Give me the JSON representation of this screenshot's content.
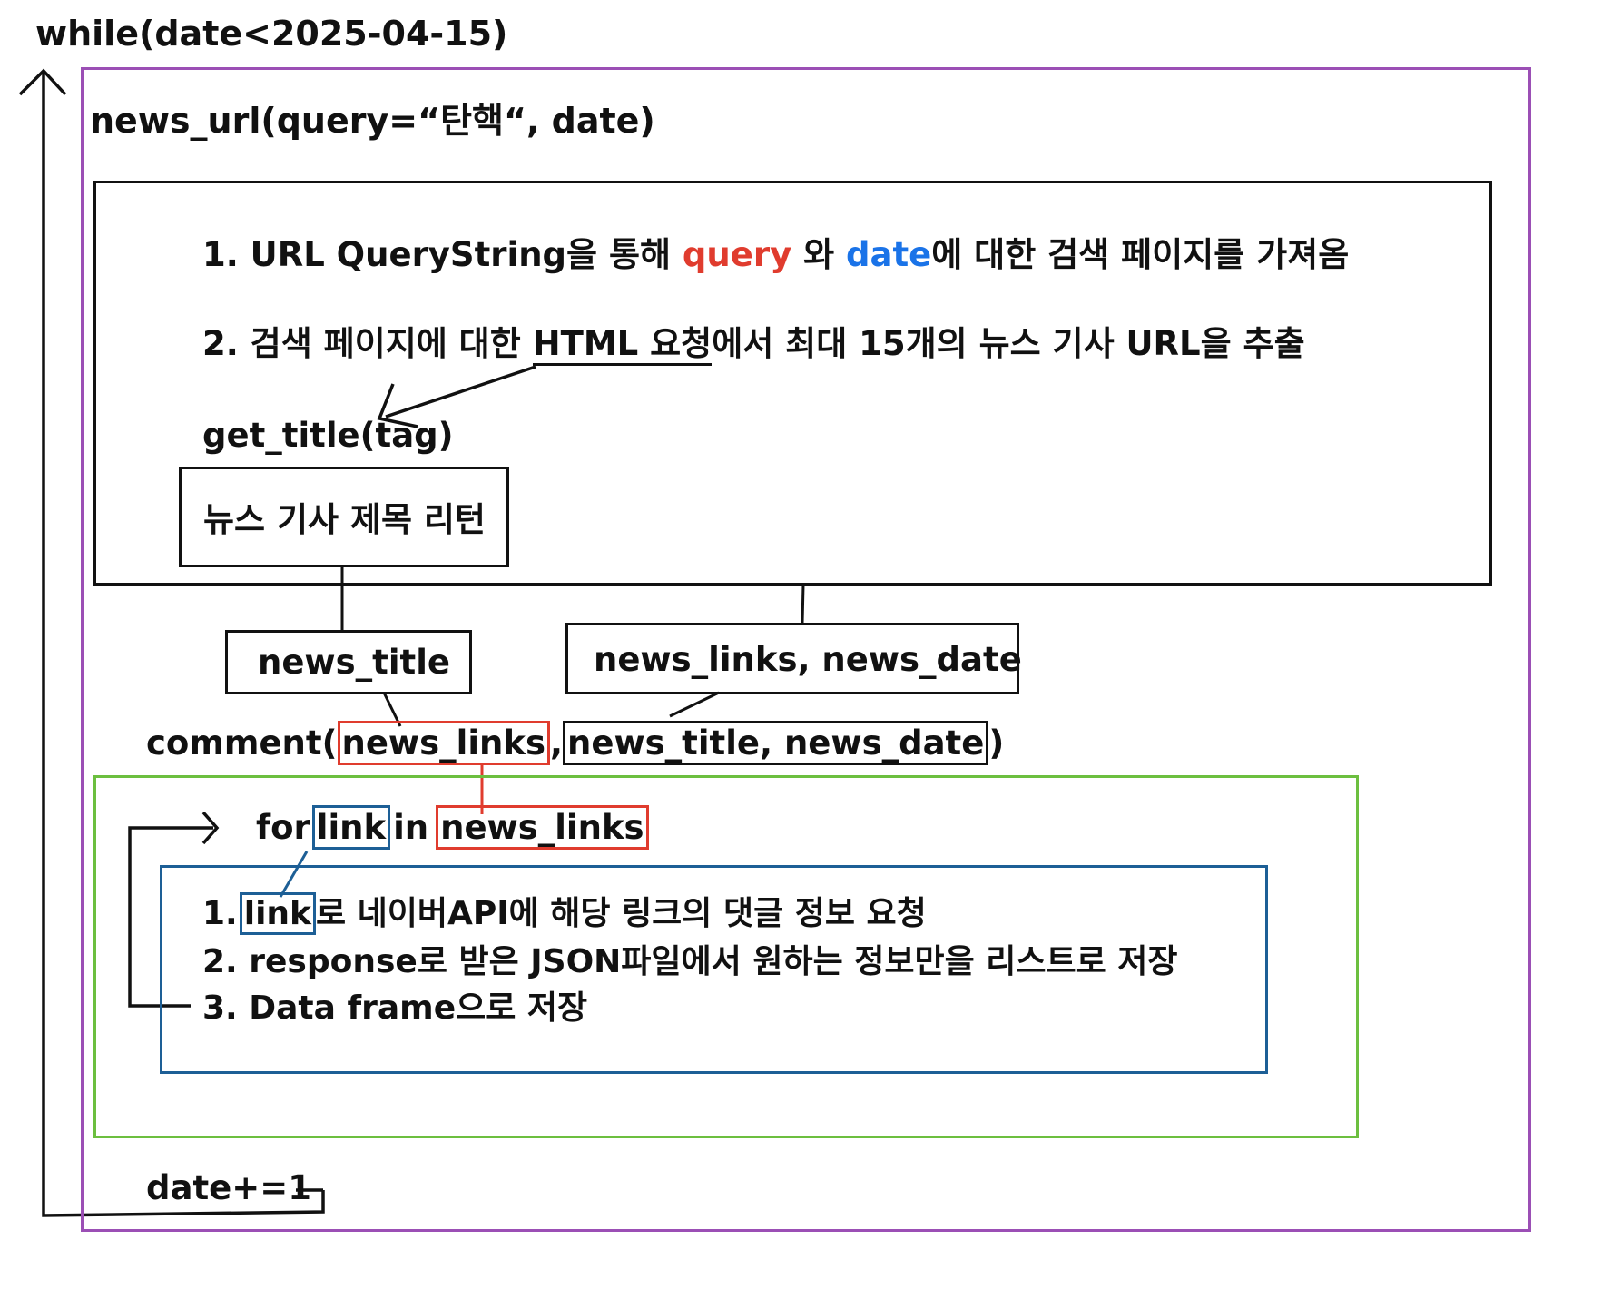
{
  "colors": {
    "outer_loop": "#9b4fb5",
    "comment_box": "#6cbf3f",
    "inner_loop": "#1d5f96",
    "highlight_red": "#e03c2e",
    "highlight_blue": "#1a73e8",
    "ink": "#111111"
  },
  "while_label": "while(date<2025-04-15)",
  "news_url": {
    "call": "news_url(query=“탄핵“, date)",
    "step1": {
      "prefix": "1. URL QueryString을 통해 ",
      "query": "query",
      "mid": " 와 ",
      "date": "date",
      "suffix": "에 대한 검색 페이지를 가져옴"
    },
    "step2": {
      "prefix": "2. 검색 페이지에 대한 ",
      "html": "HTML 요청",
      "suffix": "에서 최대 15개의 뉴스 기사 URL을 추출"
    },
    "get_title_call": "get_title(tag)",
    "get_title_box": "뉴스 기사 제목 리턴"
  },
  "outputs": {
    "news_title": "news_title",
    "news_links_date": "news_links, news_date"
  },
  "comment": {
    "prefix": "comment(",
    "arg1": "news_links",
    "comma": ",",
    "arg2": "news_title, news_date",
    "suffix": ")"
  },
  "loop": {
    "for": "for",
    "var": "link",
    "in": "in",
    "iter": "news_links",
    "step1_num": "1.",
    "step1_link": "link",
    "step1_text": "로 네이버API에 해당 링크의 댓글 정보 요청",
    "step2": "2. response로 받은 JSON파일에서 원하는 정보만을 리스트로 저장",
    "step3": "3. Data frame으로 저장"
  },
  "increment": "date+=1"
}
